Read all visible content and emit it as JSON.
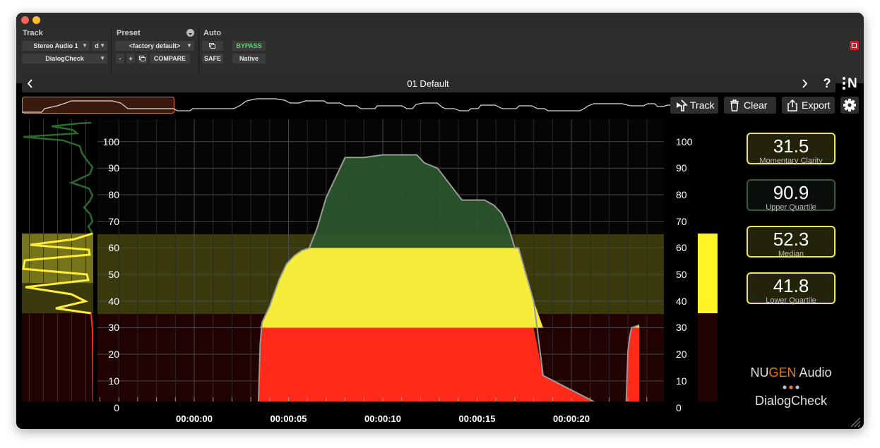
{
  "header": {
    "track_label": "Track",
    "track_select": "Stereo Audio 1",
    "track_d": "d",
    "plugin_select": "DialogCheck",
    "preset_label": "Preset",
    "preset_select": "<factory default>",
    "minus": "-",
    "plus": "+",
    "compare": "COMPARE",
    "auto_label": "Auto",
    "safe": "SAFE",
    "bypass": "BYPASS",
    "native": "Native"
  },
  "nav": {
    "title": "01 Default",
    "help": "?",
    "logo": "N"
  },
  "toolbar": {
    "track": "Track",
    "clear": "Clear",
    "export": "Export"
  },
  "axis": {
    "y_ticks": [
      "100",
      "90",
      "80",
      "70",
      "60",
      "50",
      "40",
      "30",
      "20",
      "10",
      "0"
    ],
    "y_ticks_right": [
      "100",
      "90",
      "80",
      "70",
      "60",
      "50",
      "40",
      "30",
      "20",
      "10",
      "0"
    ],
    "x_ticks": [
      "00:00:00",
      "00:00:05",
      "00:00:10",
      "00:00:15",
      "00:00:20"
    ]
  },
  "metrics": [
    {
      "value": "31.5",
      "label": "Momentary Clarity",
      "color": "#f2e74a"
    },
    {
      "value": "90.9",
      "label": "Upper Quartile",
      "color": "#3c5a3c"
    },
    {
      "value": "52.3",
      "label": "Median",
      "color": "#f2e74a"
    },
    {
      "value": "41.8",
      "label": "Lower Quartile",
      "color": "#f2e74a"
    }
  ],
  "brand": {
    "nu": "NU",
    "gen": "GEN",
    "audio": " Audio",
    "product": "DialogCheck"
  },
  "colors": {
    "yellow": "#f5ed3a",
    "green": "#2d5a2d",
    "red": "#ff2a1a",
    "orange": "#e47a1e"
  },
  "chart_data": {
    "type": "line",
    "xlabel": "",
    "ylabel": "",
    "ylim": [
      0,
      100
    ],
    "x_ticks": [
      "00:00:00",
      "00:00:05",
      "00:00:10",
      "00:00:15",
      "00:00:20"
    ],
    "x_units": "seconds",
    "bands": [
      {
        "range": [
          0,
          30
        ],
        "color": "red"
      },
      {
        "range": [
          30,
          60
        ],
        "color": "yellow"
      },
      {
        "range": [
          60,
          100
        ],
        "color": "green"
      }
    ],
    "series": [
      {
        "x": [
          -5.2,
          -0.5,
          0,
          3.4,
          3.5,
          3.6,
          3.8,
          4.0,
          4.2,
          4.5,
          4.9,
          5.3,
          5.7,
          6.1,
          6.1,
          6.5,
          7.0,
          8.0,
          9.0,
          10.0,
          11.0,
          11.8,
          12.2,
          12.9,
          14.2,
          15.0,
          15.4,
          15.9,
          16.3,
          16.7,
          17.0,
          17.2,
          18.0,
          18.5,
          21.8,
          22.9,
          23.0,
          23.1,
          23.2,
          23.6
        ],
        "y": [
          0,
          0,
          0,
          0,
          24,
          32,
          35,
          38,
          42,
          48,
          54,
          57,
          59,
          60,
          60,
          67,
          79,
          94,
          94,
          95,
          95,
          95,
          92,
          90,
          78,
          78,
          78,
          76,
          73,
          67,
          60,
          60,
          40,
          12,
          0,
          0,
          21,
          27,
          30,
          31
        ]
      }
    ],
    "current_level": 31.5
  }
}
